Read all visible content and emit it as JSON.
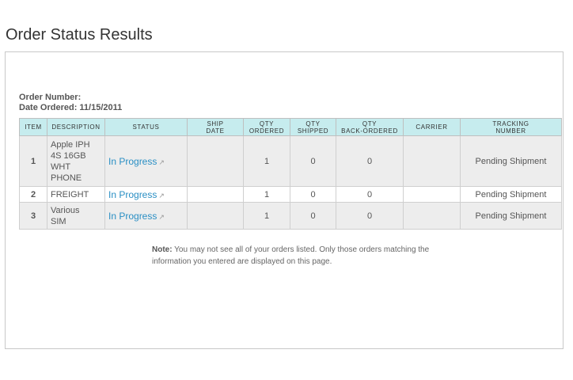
{
  "page": {
    "title": "Order Status Results"
  },
  "order": {
    "number_label": "Order Number:",
    "date_label": "Date Ordered: 11/15/2011"
  },
  "table": {
    "headers": {
      "item": "ITEM",
      "description": "DESCRIPTION",
      "status": "STATUS",
      "ship_date_1": "SHIP",
      "ship_date_2": "DATE",
      "qty_ordered_1": "QTY",
      "qty_ordered_2": "ORDERED",
      "qty_shipped_1": "QTY",
      "qty_shipped_2": "SHIPPED",
      "qty_backordered_1": "QTY",
      "qty_backordered_2": "BACK-ORDERED",
      "carrier": "CARRIER",
      "tracking_1": "TRACKING",
      "tracking_2": "NUMBER"
    },
    "rows": [
      {
        "item": "1",
        "description_lines": [
          "Apple IPH",
          "4S 16GB",
          "WHT",
          "PHONE"
        ],
        "status": "In Progress",
        "ship_date": "",
        "qty_ordered": "1",
        "qty_shipped": "0",
        "qty_backordered": "0",
        "carrier": "",
        "tracking": "Pending Shipment"
      },
      {
        "item": "2",
        "description_lines": [
          "FREIGHT"
        ],
        "status": "In Progress",
        "ship_date": "",
        "qty_ordered": "1",
        "qty_shipped": "0",
        "qty_backordered": "0",
        "carrier": "",
        "tracking": "Pending Shipment"
      },
      {
        "item": "3",
        "description_lines": [
          "Various",
          "SIM"
        ],
        "status": "In Progress",
        "ship_date": "",
        "qty_ordered": "1",
        "qty_shipped": "0",
        "qty_backordered": "0",
        "carrier": "",
        "tracking": "Pending Shipment"
      }
    ]
  },
  "note": {
    "label": "Note:",
    "text": " You may not see all of your orders listed. Only those orders matching the information you entered are displayed on this page."
  },
  "icons": {
    "external_link": "external-link-icon"
  },
  "colors": {
    "header_bg": "#c6ecee",
    "link": "#2a8fc4",
    "row_shade": "#ededed"
  }
}
